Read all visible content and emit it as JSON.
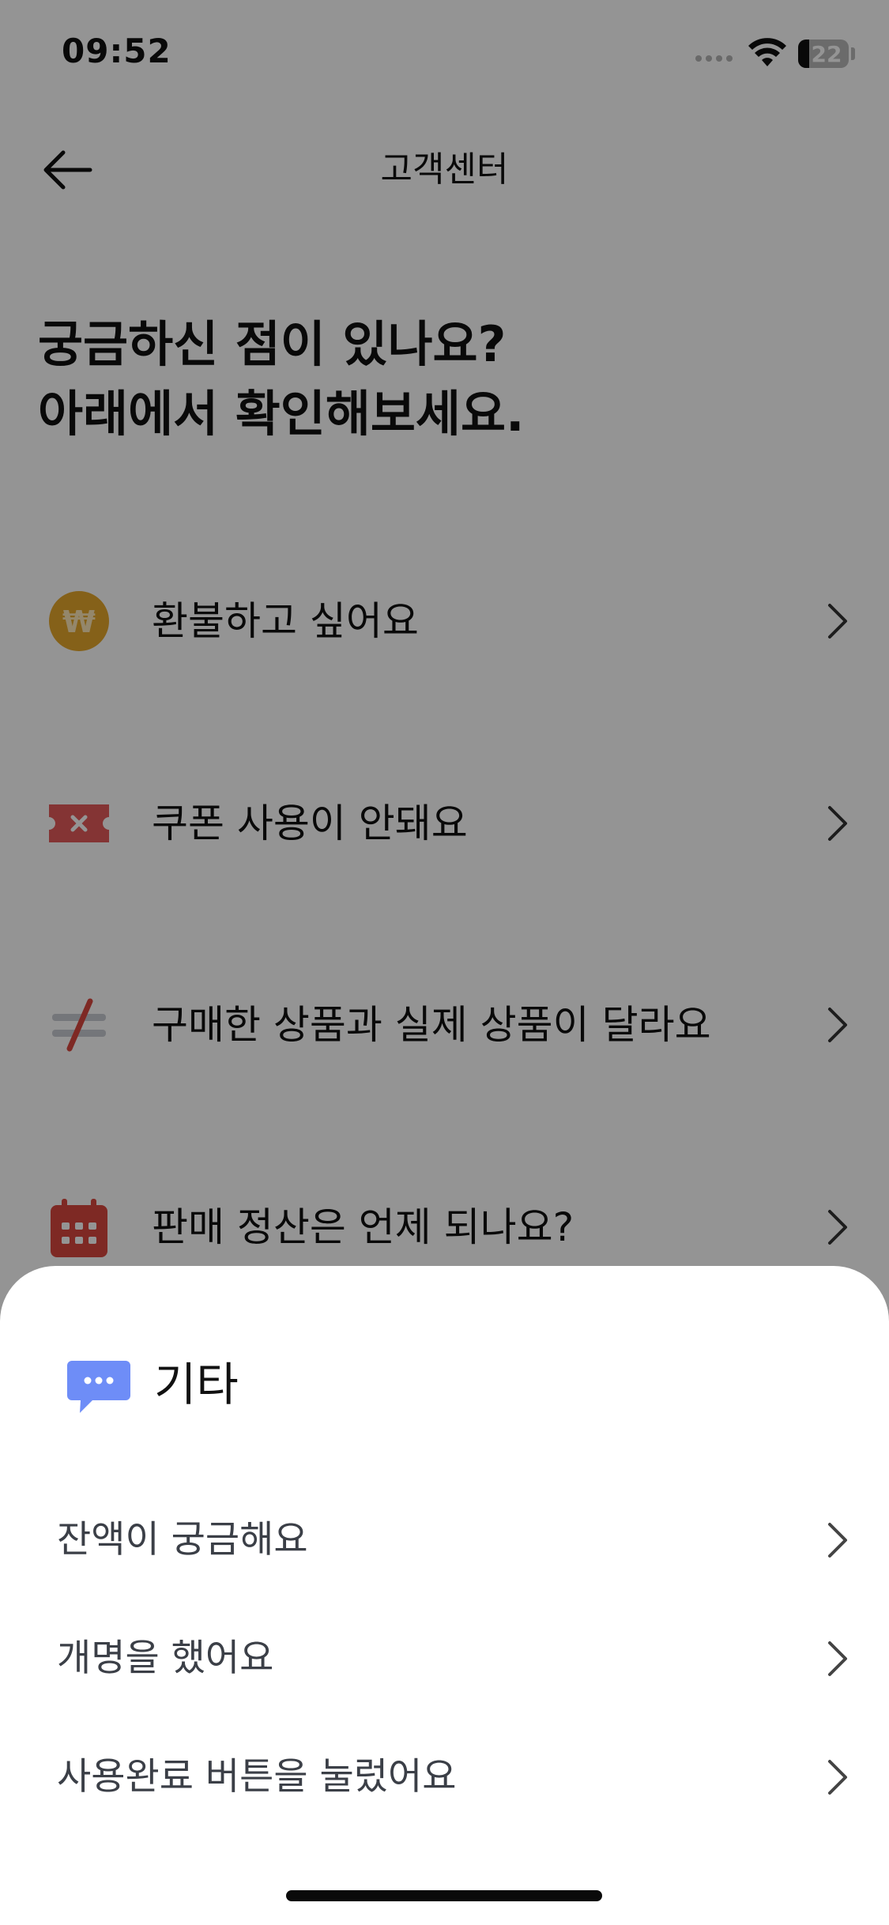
{
  "status_bar": {
    "time": "09:52",
    "battery": "22"
  },
  "nav": {
    "title": "고객센터"
  },
  "heading": {
    "line1": "궁금하신 점이 있나요?",
    "line2": "아래에서 확인해보세요."
  },
  "faq": [
    {
      "label": "환불하고 싶어요",
      "icon": "won-coin-icon"
    },
    {
      "label": "쿠폰 사용이 안돼요",
      "icon": "coupon-x-icon"
    },
    {
      "label": "구매한 상품과 실제 상품이 달라요",
      "icon": "not-equal-icon"
    },
    {
      "label": "판매 정산은 언제 되나요?",
      "icon": "calendar-icon"
    }
  ],
  "sheet": {
    "title": "기타",
    "icon": "chat-bubble-icon",
    "items": [
      {
        "label": "잔액이 궁금해요"
      },
      {
        "label": "개명을 했어요"
      },
      {
        "label": "사용완료 버튼을 눌렀어요"
      }
    ]
  },
  "colors": {
    "coin": "#E6A82B",
    "coupon": "#E35A5A",
    "calendar": "#D9483F",
    "chat": "#6E8DF7",
    "dim": "rgba(0,0,0,0.42)"
  }
}
